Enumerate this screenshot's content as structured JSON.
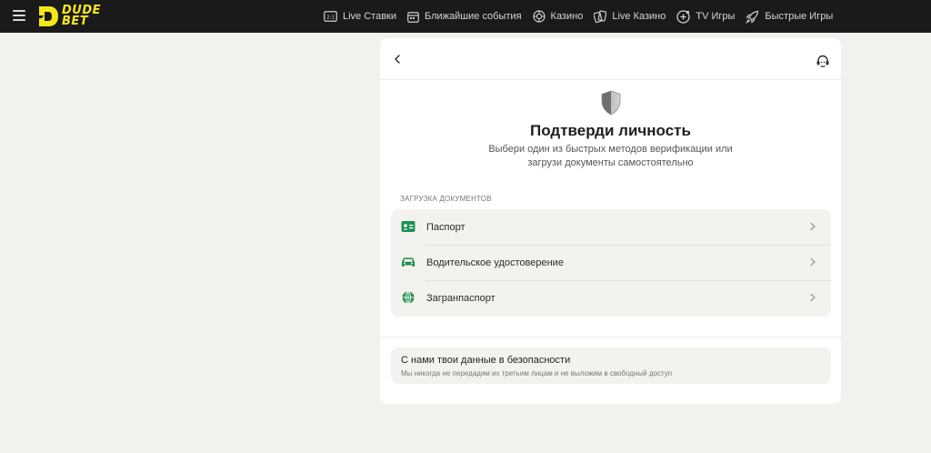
{
  "brand": {
    "line1": "DUDE",
    "line2": "BET",
    "accent": "#f5e61b"
  },
  "nav": [
    {
      "label": "Live Ставки",
      "icon": "live-bets-icon"
    },
    {
      "label": "Ближайшие события",
      "icon": "calendar-icon"
    },
    {
      "label": "Казино",
      "icon": "casino-chip-icon"
    },
    {
      "label": "Live Казино",
      "icon": "cards-icon"
    },
    {
      "label": "TV Игры",
      "icon": "tv-games-icon"
    },
    {
      "label": "Быстрые Игры",
      "icon": "rocket-icon"
    }
  ],
  "verify": {
    "title": "Подтверди личность",
    "subtitle": "Выбери один из быстрых методов верификации или загрузи документы самостоятельно",
    "section_label": "ЗАГРУЗКА ДОКУМЕНТОВ",
    "documents": [
      {
        "label": "Паспорт",
        "icon": "id-card-icon"
      },
      {
        "label": "Водительское удостоверение",
        "icon": "car-icon"
      },
      {
        "label": "Загранпаспорт",
        "icon": "globe-icon"
      }
    ],
    "safety_title": "С нами твои данные в безопасности",
    "safety_text": "Мы никогда не передадим их третьим лицам и не выложим в свободный доступ"
  },
  "colors": {
    "icon_green": "#1f8f52",
    "topbar": "#1a1a1a",
    "page_bg": "#f2f1ed"
  }
}
